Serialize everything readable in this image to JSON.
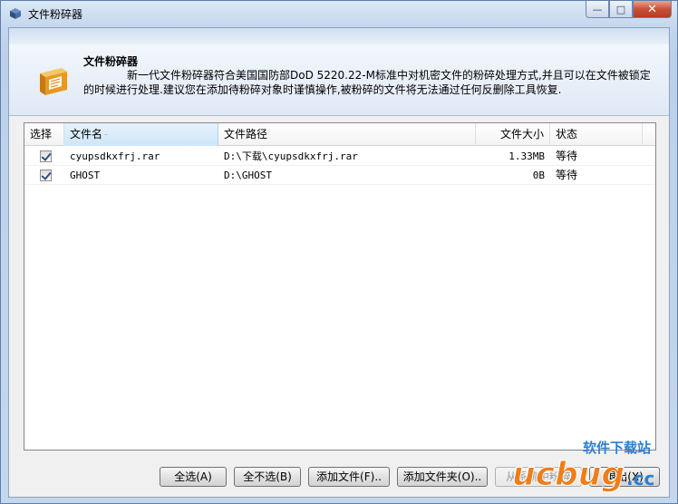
{
  "window": {
    "title": "文件粉碎器",
    "controls": {
      "minimize": "—",
      "maximize": "□",
      "close": "✕"
    }
  },
  "header": {
    "title": "文件粉碎器",
    "description": "新一代文件粉碎器符合美国国防部DoD 5220.22-M标准中对机密文件的粉碎处理方式,并且可以在文件被锁定的时候进行处理.建议您在添加待粉碎对象时谨慎操作,被粉碎的文件将无法通过任何反删除工具恢复."
  },
  "list": {
    "columns": {
      "select": "选择",
      "name": "文件名",
      "path": "文件路径",
      "size": "文件大小",
      "status": "状态"
    },
    "rows": [
      {
        "checked": true,
        "name": "cyupsdkxfrj.rar",
        "path": "D:\\下载\\cyupsdkxfrj.rar",
        "size": "1.33MB",
        "status": "等待"
      },
      {
        "checked": true,
        "name": "GHOST",
        "path": "D:\\GHOST",
        "size": "0B",
        "status": "等待"
      }
    ]
  },
  "buttons": {
    "select_all": "全选(A)",
    "select_none": "全不选(B)",
    "add_file": "添加文件(F)..",
    "add_folder": "添加文件夹(O)..",
    "shred": "从系统中粉碎",
    "exit": "退出(X)"
  },
  "watermark": {
    "brand": "ucbug",
    "suffix": ".cc",
    "tagline": "软件下载站"
  }
}
